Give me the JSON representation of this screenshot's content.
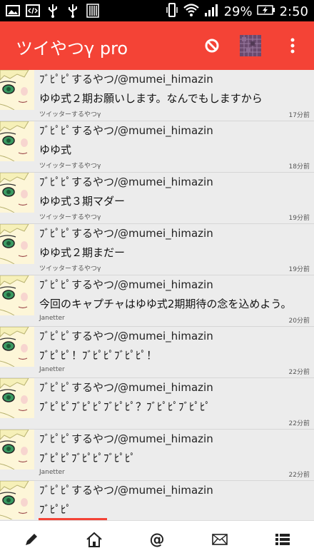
{
  "statusbar": {
    "battery": "29%",
    "time": "2:50"
  },
  "appbar": {
    "title": "ツイやつγ pro"
  },
  "tweets": [
    {
      "name": "ﾌﾞﾋﾟﾋﾟするやつ/@mumei_himazin",
      "text": "ゆゆ式２期お願いします。なんでもしますから",
      "client": "ツイッターするやつγ",
      "time": "17分前"
    },
    {
      "name": "ﾌﾞﾋﾟﾋﾟするやつ/@mumei_himazin",
      "text": "ゆゆ式",
      "client": "ツイッターするやつγ",
      "time": "18分前"
    },
    {
      "name": "ﾌﾞﾋﾟﾋﾟするやつ/@mumei_himazin",
      "text": "ゆゆ式３期マダー",
      "client": "ツイッターするやつγ",
      "time": "19分前"
    },
    {
      "name": "ﾌﾞﾋﾟﾋﾟするやつ/@mumei_himazin",
      "text": "ゆゆ式２期まだー",
      "client": "ツイッターするやつγ",
      "time": "19分前"
    },
    {
      "name": "ﾌﾞﾋﾟﾋﾟするやつ/@mumei_himazin",
      "text": "今回のキャプチャはゆゆ式2期期待の念を込めよう。",
      "client": "Janetter",
      "time": "20分前"
    },
    {
      "name": "ﾌﾞﾋﾟﾋﾟするやつ/@mumei_himazin",
      "text": "ﾌﾞﾋﾟﾋﾟ！ﾌﾞﾋﾟﾋﾟﾌﾞﾋﾟﾋﾟ！",
      "client": "Janetter",
      "time": "22分前"
    },
    {
      "name": "ﾌﾞﾋﾟﾋﾟするやつ/@mumei_himazin",
      "text": "ﾌﾞﾋﾟﾋﾟﾌﾞﾋﾟﾋﾟﾌﾞﾋﾟﾋﾟ？ﾌﾞﾋﾟﾋﾟﾌﾞﾋﾟﾋﾟ",
      "client": "",
      "time": "22分前"
    },
    {
      "name": "ﾌﾞﾋﾟﾋﾟするやつ/@mumei_himazin",
      "text": "ﾌﾞﾋﾟﾋﾟﾌﾞﾋﾟﾋﾟﾌﾞﾋﾟﾋﾟ",
      "client": "Janetter",
      "time": "22分前"
    },
    {
      "name": "ﾌﾞﾋﾟﾋﾟするやつ/@mumei_himazin",
      "text": "ﾌﾞﾋﾟﾋﾟ",
      "client": "",
      "time": ""
    }
  ],
  "bottombar": {
    "icons": [
      "compose-icon",
      "home-icon",
      "mention-icon",
      "mail-icon",
      "list-icon"
    ]
  },
  "colors": {
    "accent": "#f44336"
  }
}
